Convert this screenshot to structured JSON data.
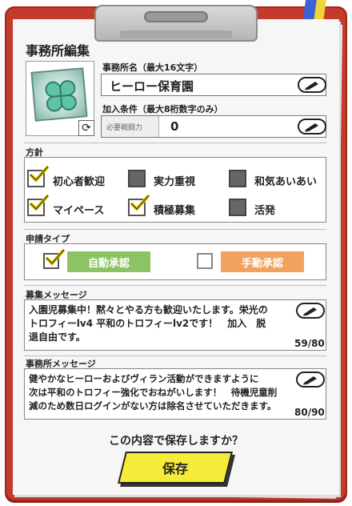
{
  "header": {
    "title": "事務所編集"
  },
  "office_name": {
    "label": "事務所名（最大16文字）",
    "value": "ヒーロー保育園"
  },
  "join_condition": {
    "label": "加入条件（最大8桁数字のみ）",
    "sub_label": "必要戦闘力",
    "value": "0"
  },
  "policy": {
    "label": "方針",
    "options": [
      {
        "label": "初心者歓迎",
        "checked": true
      },
      {
        "label": "実力重視",
        "checked": false
      },
      {
        "label": "和気あいあい",
        "checked": false
      },
      {
        "label": "マイペース",
        "checked": true
      },
      {
        "label": "積極募集",
        "checked": true
      },
      {
        "label": "活発",
        "checked": false
      }
    ]
  },
  "application_type": {
    "label": "申請タイプ",
    "auto_label": "自動承認",
    "manual_label": "手動承認",
    "selected": "自動承認",
    "colors": {
      "auto": "#8cc465",
      "manual": "#f0a25e"
    }
  },
  "recruit_message": {
    "label": "募集メッセージ",
    "lines": [
      "入園児募集中！黙々とやる方も歓迎いたします。栄光の",
      "トロフィーlv4 平和のトロフィーlv2です！　加入　脱",
      "退自由です。"
    ],
    "counter": "59/80"
  },
  "office_message": {
    "label": "事務所メッセージ",
    "lines": [
      "健やかなヒーローおよびヴィラン活動ができますように",
      "次は平和のトロフィー強化でおねがいします！　待機児童削",
      "減のため数日ログインがない方は除名させていただきます。"
    ],
    "counter": "80/90"
  },
  "confirm": {
    "question": "この内容で保存しますか？",
    "save_label": "保存"
  },
  "icons": {
    "emblem": "clover-emblem-icon",
    "rotate": "rotate-icon",
    "edit": "pencil-icon"
  }
}
